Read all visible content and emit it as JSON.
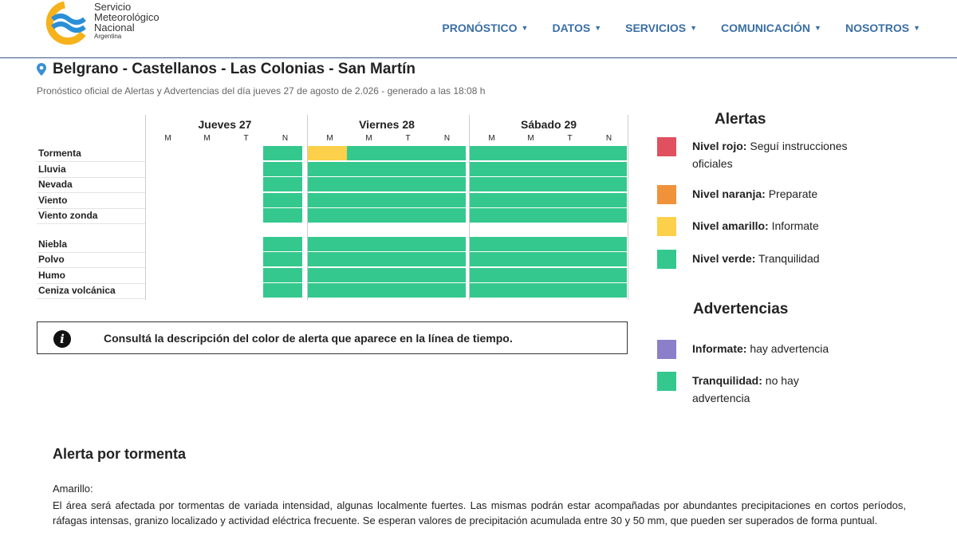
{
  "logo": {
    "line1": "Servicio",
    "line2": "Meteorológico",
    "line3": "Nacional",
    "line4": "Argentina"
  },
  "nav": [
    {
      "label": "PRONÓSTICO"
    },
    {
      "label": "DATOS"
    },
    {
      "label": "SERVICIOS"
    },
    {
      "label": "COMUNICACIÓN"
    },
    {
      "label": "NOSOTROS"
    }
  ],
  "location": {
    "title": "Belgrano - Castellanos - Las Colonias - San Martín",
    "icon": "map-pin-icon"
  },
  "subtitle": "Pronóstico oficial de Alertas y Advertencias del día jueves 27 de agosto de 2.026 - generado a las 18:08 h",
  "grid": {
    "days": [
      "Jueves 27",
      "Viernes 28",
      "Sábado 29"
    ],
    "slots": [
      "M",
      "M",
      "T",
      "N"
    ],
    "rows_group1": [
      "Tormenta",
      "Lluvia",
      "Nevada",
      "Viento",
      "Viento zonda"
    ],
    "rows_group2": [
      "Niebla",
      "Polvo",
      "Humo",
      "Ceniza volcánica"
    ],
    "colors": {
      "green": "#35c88e",
      "yellow": "#fcd04a"
    }
  },
  "info_box": {
    "text": "Consultá la descripción del color de alerta que aparece en la línea de tiempo."
  },
  "alertas": {
    "title": "Alertas",
    "items": [
      {
        "strong": "Nivel rojo:",
        "text": " Seguí instrucciones oficiales",
        "color": "#e0505e"
      },
      {
        "strong": "Nivel naranja:",
        "text": " Preparate",
        "color": "#f0923a"
      },
      {
        "strong": "Nivel amarillo:",
        "text": " Informate",
        "color": "#fcd04a"
      },
      {
        "strong": "Nivel verde:",
        "text": " Tranquilidad",
        "color": "#35c88e"
      }
    ]
  },
  "advertencias": {
    "title": "Advertencias",
    "items": [
      {
        "strong": "Informate:",
        "text": " hay advertencia",
        "color": "#8a7fc8"
      },
      {
        "strong": "Tranquilidad:",
        "text": " no hay advertencia",
        "color": "#35c88e"
      }
    ]
  },
  "section": {
    "title": "Alerta por tormenta",
    "subtitle": "Amarillo:",
    "body": "El área será afectada por tormentas de variada intensidad, algunas localmente fuertes. Las mismas podrán estar acompañadas por abundantes precipitaciones en cortos períodos, ráfagas intensas, granizo localizado y actividad eléctrica frecuente. Se esperan valores de precipitación acumulada entre 30 y 50 mm, que pueden ser superados de forma puntual."
  }
}
